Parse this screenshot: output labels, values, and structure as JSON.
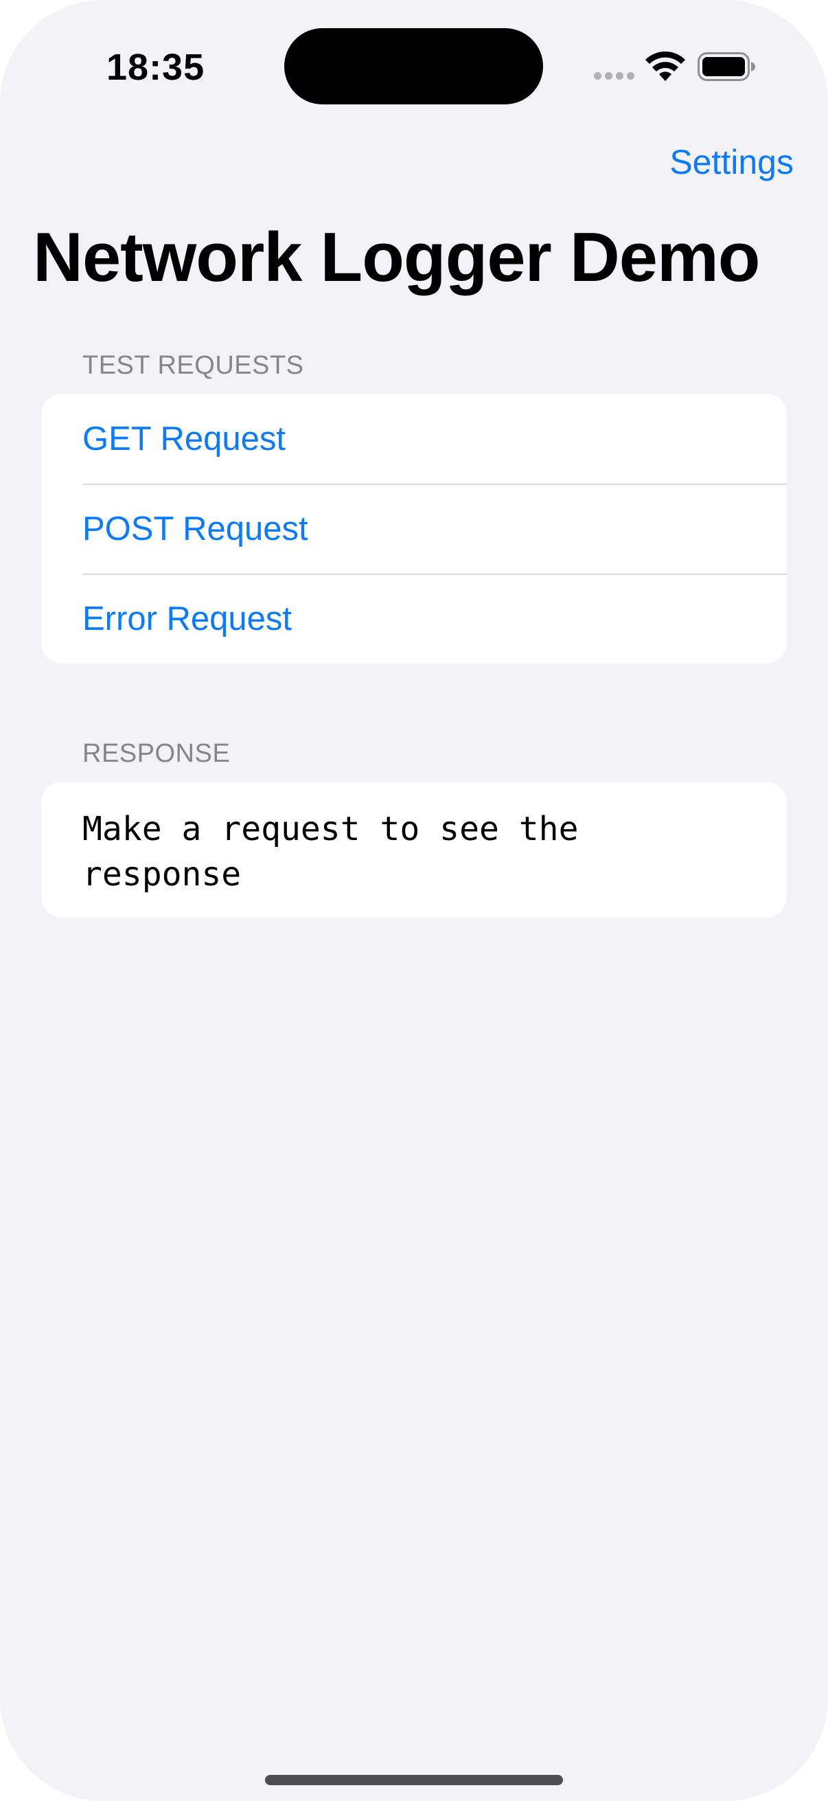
{
  "status_bar": {
    "time": "18:35"
  },
  "nav": {
    "settings_label": "Settings"
  },
  "title": "Network Logger Demo",
  "sections": {
    "test_requests": {
      "header": "TEST REQUESTS",
      "items": [
        {
          "label": "GET Request"
        },
        {
          "label": "POST Request"
        },
        {
          "label": "Error Request"
        }
      ]
    },
    "response": {
      "header": "RESPONSE",
      "text": "Make a request to see the response"
    }
  },
  "colors": {
    "background": "#f2f2f7",
    "card": "#ffffff",
    "accent": "#0a7aff",
    "header_gray": "#85858b"
  },
  "icons": [
    "signal-icon",
    "wifi-icon",
    "battery-icon"
  ]
}
